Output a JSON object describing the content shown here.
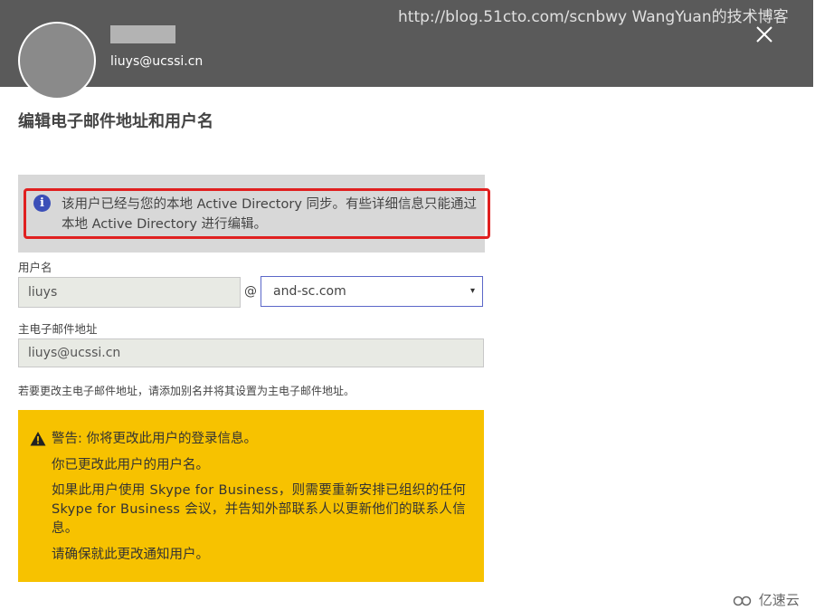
{
  "header": {
    "email": "liuys@ucssi.cn",
    "watermark": "http://blog.51cto.com/scnbwy WangYuan的技术博客",
    "close_icon": "close-icon"
  },
  "page": {
    "title": "编辑电子邮件地址和用户名"
  },
  "info": {
    "icon": "info-icon",
    "icon_glyph": "i",
    "text": "该用户已经与您的本地 Active Directory 同步。有些详细信息只能通过本地 Active Directory 进行编辑。"
  },
  "username": {
    "label": "用户名",
    "value": "liuys",
    "at": "@",
    "domain": "and-sc.com",
    "domain_arrow": "▾"
  },
  "primary_email": {
    "label": "主电子邮件地址",
    "value": "liuys@ucssi.cn"
  },
  "hint": "若要更改主电子邮件地址，请添加别名并将其设置为主电子邮件地址。",
  "warning": {
    "icon": "warning-icon",
    "line1": "警告: 你将更改此用户的登录信息。",
    "line2": "你已更改此用户的用户名。",
    "para": "如果此用户使用 Skype for Business，则需要重新安排已组织的任何 Skype for Business 会议，并告知外部联系人以更新他们的联系人信息。",
    "line4": "请确保就此更改通知用户。"
  },
  "footer": {
    "logo_text": "亿速云",
    "logo_icon": "cloud-logo-icon"
  },
  "colors": {
    "header_bg": "#5a5a5a",
    "info_bg": "#d8d8d8",
    "highlight_border": "#e02020",
    "info_icon": "#3b4fb8",
    "warning_bg": "#f7c200",
    "select_border": "#5b67c8"
  }
}
